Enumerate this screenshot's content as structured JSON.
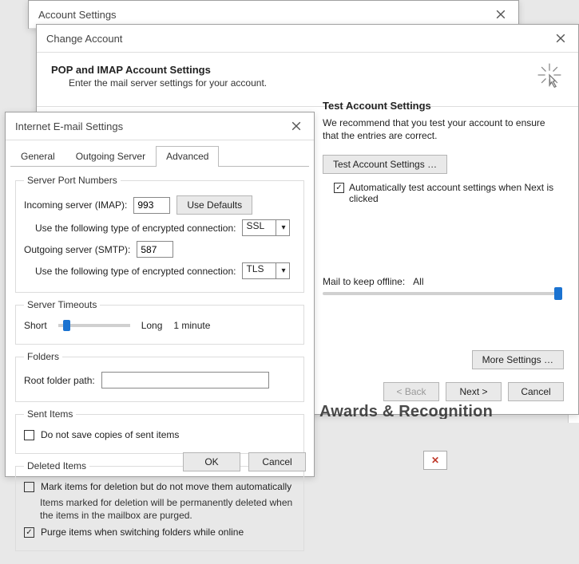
{
  "accountSettings": {
    "title": "Account Settings"
  },
  "changeAccount": {
    "title": "Change Account",
    "banner_heading": "POP and IMAP Account Settings",
    "banner_sub": "Enter the mail server settings for your account.",
    "test_heading": "Test Account Settings",
    "test_text": "We recommend that you test your account to ensure that the entries are correct.",
    "test_btn": "Test Account Settings …",
    "auto_test_label": "Automatically test account settings when Next is clicked",
    "auto_test_checked": true,
    "mail_keep_label": "Mail to keep offline:",
    "mail_keep_value": "All",
    "more_settings_btn": "More Settings …",
    "back_btn": "< Back",
    "next_btn": "Next >",
    "cancel_btn": "Cancel"
  },
  "emailSettings": {
    "title": "Internet E-mail Settings",
    "tabs": {
      "general": "General",
      "outgoing": "Outgoing Server",
      "advanced": "Advanced"
    },
    "active_tab": "advanced",
    "ports": {
      "legend": "Server Port Numbers",
      "incoming_label": "Incoming server (IMAP):",
      "incoming_value": "993",
      "use_defaults_btn": "Use Defaults",
      "incoming_enc_label": "Use the following type of encrypted connection:",
      "incoming_enc_value": "SSL",
      "outgoing_label": "Outgoing server (SMTP):",
      "outgoing_value": "587",
      "outgoing_enc_label": "Use the following type of encrypted connection:",
      "outgoing_enc_value": "TLS"
    },
    "timeouts": {
      "legend": "Server Timeouts",
      "short": "Short",
      "long": "Long",
      "value_text": "1 minute"
    },
    "folders": {
      "legend": "Folders",
      "root_label": "Root folder path:",
      "root_value": ""
    },
    "sent": {
      "legend": "Sent Items",
      "dont_save_label": "Do not save copies of sent items",
      "dont_save_checked": false
    },
    "deleted": {
      "legend": "Deleted Items",
      "mark_label": "Mark items for deletion but do not move them automatically",
      "mark_checked": false,
      "mark_note": "Items marked for deletion will be permanently deleted when the items in the mailbox are purged.",
      "purge_label": "Purge items when switching folders while online",
      "purge_checked": true
    },
    "ok_btn": "OK",
    "cancel_btn": "Cancel"
  },
  "bg": {
    "awards_text": "Awards & Recognition",
    "broken_img_glyph": "✕"
  }
}
